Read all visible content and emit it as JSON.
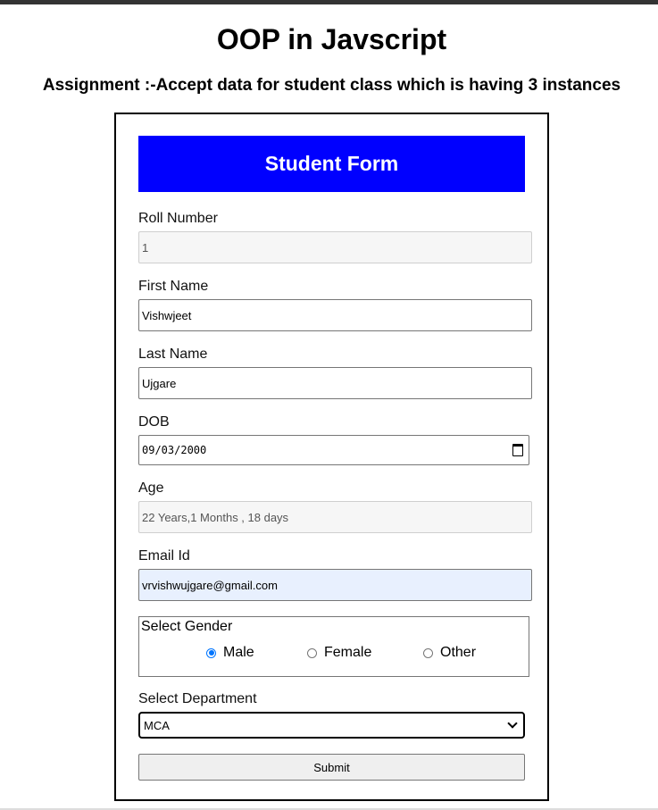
{
  "page": {
    "title": "OOP in Javscript",
    "subtitle": "Assignment :-Accept data for student class which is having 3 instances"
  },
  "form": {
    "header": "Student Form",
    "roll": {
      "label": "Roll Number",
      "value": "1"
    },
    "first_name": {
      "label": "First Name",
      "value": "Vishwjeet"
    },
    "last_name": {
      "label": "Last Name",
      "value": "Ujgare"
    },
    "dob": {
      "label": "DOB",
      "value": "09/03/2000"
    },
    "age": {
      "label": "Age",
      "value": "22 Years,1 Months , 18 days"
    },
    "email": {
      "label": "Email Id",
      "value": "vrvishwujgare@gmail.com"
    },
    "gender": {
      "label": "Select Gender",
      "options": [
        "Male",
        "Female",
        "Other"
      ],
      "selected": "Male"
    },
    "department": {
      "label": "Select Department",
      "value": "MCA"
    },
    "submit_label": "Submit"
  }
}
